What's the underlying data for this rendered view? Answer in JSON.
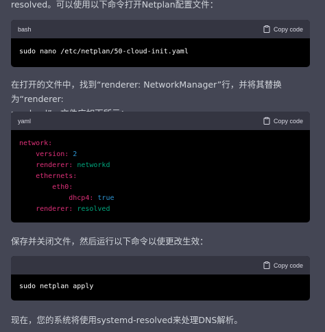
{
  "paragraphs": {
    "p1": "resolved。可以使用以下命令打开Netplan配置文件：",
    "p2_line1": "在打开的文件中，找到“renderer: NetworkManager”行，并将其替换为“renderer:",
    "p2_line2": "resolved”。文件应如下所示：",
    "p3": "保存并关闭文件，然后运行以下命令以使更改生效：",
    "p4": "现在，您的系统将使用systemd-resolved来处理DNS解析。"
  },
  "code_blocks": [
    {
      "language": "bash",
      "copy_label": "Copy code",
      "command": "sudo nano /etc/netplan/50-cloud-init.yaml"
    },
    {
      "language": "yaml",
      "copy_label": "Copy code",
      "lines": {
        "l1_key": "network:",
        "l2_key": "version:",
        "l2_val": "2",
        "l3_key": "renderer:",
        "l3_val": "networkd",
        "l4_key": "ethernets:",
        "l5_key": "eth0:",
        "l6_key": "dhcp4:",
        "l6_val": "true",
        "l7_key": "renderer:",
        "l7_val": "resolved"
      }
    },
    {
      "language": "bash",
      "copy_label": "Copy code",
      "command": "sudo netplan apply"
    }
  ],
  "icons": {
    "copy": "clipboard-icon"
  },
  "colors": {
    "background": "#444654",
    "code_bg": "#000000",
    "code_header_bg": "#343541",
    "yaml_key": "#df3079",
    "yaml_string": "#00a67d",
    "yaml_bool": "#2e95d3"
  }
}
